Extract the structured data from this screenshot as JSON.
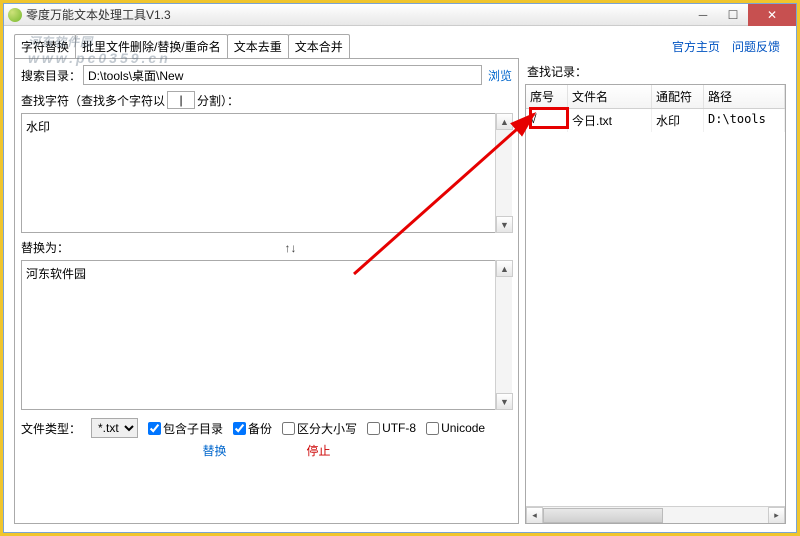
{
  "titlebar": {
    "title": "零度万能文本处理工具V1.3"
  },
  "watermark": {
    "line1": "河东软件园",
    "line2": "www.pc0359.cn"
  },
  "tabs": [
    "字符替换",
    "批里文件删除/替换/重命名",
    "文本去重",
    "文本合并"
  ],
  "links": {
    "home": "官方主页",
    "feedback": "问题反馈"
  },
  "search": {
    "dir_label": "搜索目录：",
    "dir_value": "D:\\tools\\桌面\\New",
    "browse": "浏览",
    "find_label_1": "查找字符（查找多个字符以",
    "find_sep": "|",
    "find_label_2": "分割）：",
    "find_value": "水印",
    "replace_label": "替换为：",
    "replace_arrows": "↑↓",
    "replace_value": "河东软件园"
  },
  "filetype": {
    "label": "文件类型：",
    "selected": "*.txt"
  },
  "checkboxes": {
    "subdir": "包含子目录",
    "backup": "备份",
    "case": "区分大小写",
    "utf8": "UTF-8",
    "unicode": "Unicode"
  },
  "actions": {
    "replace": "替换",
    "stop": "停止"
  },
  "records": {
    "title": "查找记录：",
    "headers": [
      "席号",
      "文件名",
      "通配符",
      "路径"
    ],
    "rows": [
      {
        "c1": "√",
        "c2": "今日.txt",
        "c3": "水印",
        "c4": "D:\\tools"
      }
    ]
  }
}
